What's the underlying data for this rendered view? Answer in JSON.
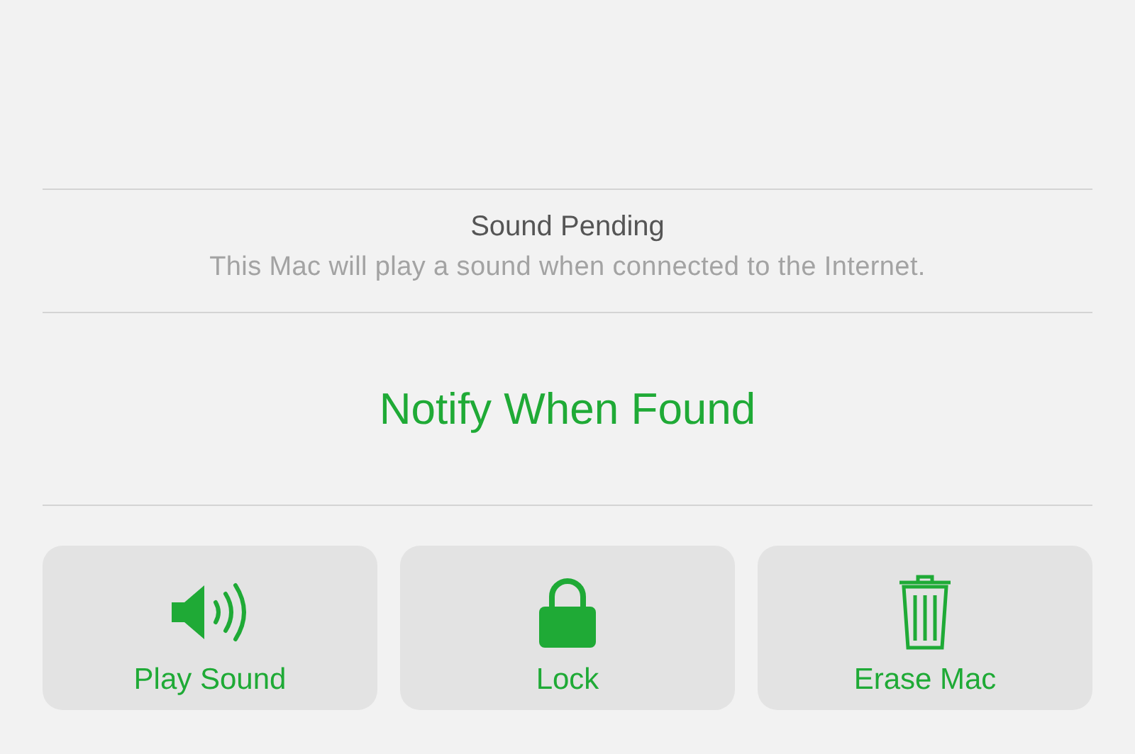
{
  "status": {
    "title": "Sound Pending",
    "message": "This Mac will play a sound when connected to the Internet."
  },
  "notify": {
    "label": "Notify When Found"
  },
  "actions": [
    {
      "kind": "sound",
      "label": "Play Sound"
    },
    {
      "kind": "lock",
      "label": "Lock"
    },
    {
      "kind": "erase",
      "label": "Erase Mac"
    }
  ]
}
